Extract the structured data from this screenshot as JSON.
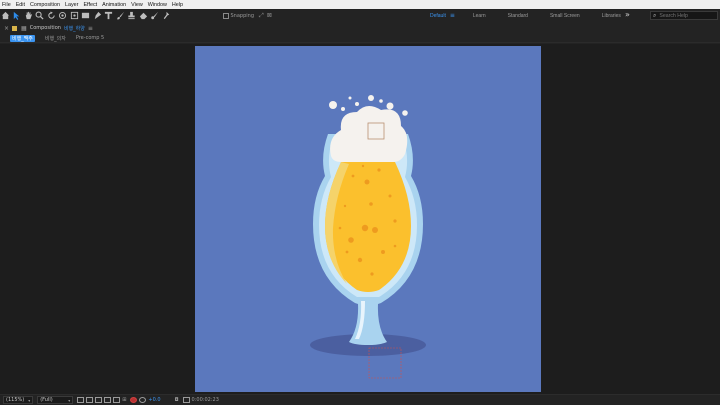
{
  "menu": [
    "File",
    "Edit",
    "Composition",
    "Layer",
    "Effect",
    "Animation",
    "View",
    "Window",
    "Help"
  ],
  "toolbar": {
    "snapping_label": "Snapping",
    "workspaces": [
      "Default",
      "Learn",
      "Standard",
      "Small Screen",
      "Libraries"
    ],
    "active_workspace": "Default",
    "search_placeholder": "Search Help"
  },
  "composition_panel": {
    "panel_title": "Composition",
    "comp_name": "비행_하양",
    "breadcrumbs": [
      "비행_맥주",
      "비행_의자",
      "Pre-comp 5"
    ]
  },
  "viewer": {
    "background_color": "#5b78bd",
    "beer_color": "#fbc02d",
    "foam_color": "#f5f2ee",
    "glass_color": "#a9d3ef"
  },
  "bottombar": {
    "zoom": "(115%)",
    "resolution": "(Full)",
    "exposure": "+0.0",
    "timecode": "0:00:02:23"
  }
}
